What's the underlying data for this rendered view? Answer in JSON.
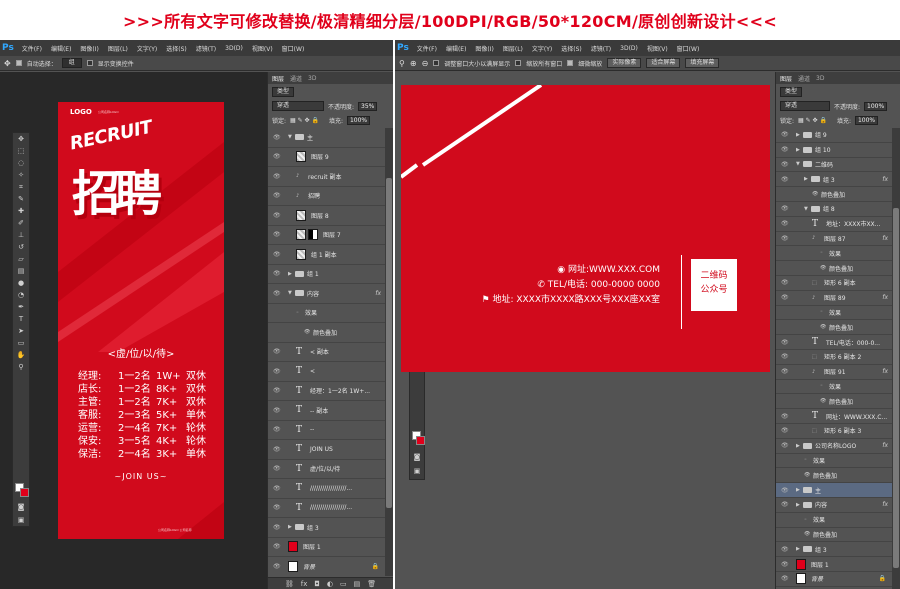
{
  "banner": ">>>所有文字可修改替换/极清精细分层/100DPI/RGB/50*120CM/原创创新设计<<<",
  "colors": {
    "accent": "#e0001b",
    "ps_bg": "#535353",
    "menubar": "#3a3a3a",
    "canvas_bg": "#282828",
    "poster_red": "#d10a1c",
    "selection": "#5b6a82"
  },
  "ps_logo": "Ps",
  "menu": [
    "文件(F)",
    "编辑(E)",
    "图像(I)",
    "图层(L)",
    "文字(Y)",
    "选择(S)",
    "滤镜(T)",
    "3D(D)",
    "视图(V)",
    "窗口(W)"
  ],
  "left_window": {
    "options": {
      "auto_select": "自动选择：",
      "target": "组",
      "show_transform": "显示变换控件"
    },
    "layers_panel": {
      "tabs": [
        "图层",
        "通道",
        "3D"
      ],
      "kind": "类型",
      "blend": "穿透",
      "opacity_label": "不透明度:",
      "opacity": "35%",
      "lock_label": "锁定:",
      "fill_label": "填充:",
      "fill": "100%",
      "layers": [
        {
          "name": "主",
          "type": "folder",
          "indent": 0,
          "open": true
        },
        {
          "name": "图层 9",
          "type": "checker",
          "indent": 1
        },
        {
          "name": "recruit 副本",
          "type": "smart",
          "indent": 1
        },
        {
          "name": "招聘",
          "type": "smart",
          "indent": 1
        },
        {
          "name": "图层 8",
          "type": "checker",
          "indent": 1
        },
        {
          "name": "图层 7",
          "type": "mask",
          "indent": 1
        },
        {
          "name": "组 1 副本",
          "type": "checker",
          "indent": 1
        },
        {
          "name": "组 1",
          "type": "folder",
          "indent": 0,
          "open": false
        },
        {
          "name": "内容",
          "type": "folder",
          "indent": 0,
          "open": true,
          "fx": "fx"
        },
        {
          "name": "效果",
          "type": "effect",
          "indent": 1
        },
        {
          "name": "颜色叠加",
          "type": "effect-item",
          "indent": 2
        },
        {
          "name": "< 副本",
          "type": "text",
          "indent": 1
        },
        {
          "name": "<",
          "type": "text",
          "indent": 1
        },
        {
          "name": "经理：1一2名 1W+...",
          "type": "text",
          "indent": 1
        },
        {
          "name": "-- 副本",
          "type": "text",
          "indent": 1
        },
        {
          "name": "--",
          "type": "text",
          "indent": 1
        },
        {
          "name": "JOIN US",
          "type": "text",
          "indent": 1
        },
        {
          "name": "虚/位/以/待",
          "type": "text",
          "indent": 1
        },
        {
          "name": "//////////////////...",
          "type": "text",
          "indent": 1
        },
        {
          "name": "//////////////////...",
          "type": "text",
          "indent": 1
        },
        {
          "name": "组 3",
          "type": "folder",
          "indent": 0,
          "open": false
        },
        {
          "name": "图层 1",
          "type": "red",
          "indent": 0
        },
        {
          "name": "背景",
          "type": "white",
          "indent": 0,
          "locked": true
        }
      ]
    },
    "bottom_icons": [
      "⛓",
      "fx",
      "◘",
      "◐",
      "▭",
      "▤",
      "🗑"
    ]
  },
  "poster": {
    "logo": "LOGO",
    "logo_sub": "公司名称LOGO",
    "recruit": "RECRUIT",
    "title": "招聘",
    "subtitle": "<虚/位/以/待>",
    "jobs": [
      {
        "role": "经理:",
        "count": "1一2名",
        "pay": "1W+",
        "rest": "双休"
      },
      {
        "role": "店长:",
        "count": "1一2名",
        "pay": "8K+",
        "rest": "双休"
      },
      {
        "role": "主管:",
        "count": "1一2名",
        "pay": "7K+",
        "rest": "双休"
      },
      {
        "role": "客服:",
        "count": "2一3名",
        "pay": "5K+",
        "rest": "单休"
      },
      {
        "role": "运营:",
        "count": "2一4名",
        "pay": "7K+",
        "rest": "轮休"
      },
      {
        "role": "保安:",
        "count": "3一5名",
        "pay": "4K+",
        "rest": "轮休"
      },
      {
        "role": "保洁:",
        "count": "2一4名",
        "pay": "3K+",
        "rest": "单休"
      }
    ],
    "join": "~JOIN US~",
    "footer": "公司名称LOGO 公司名称"
  },
  "right_window": {
    "options": [
      "调整窗口大小以满屏显示",
      "缩放所有窗口",
      "细微缩放",
      "实际像素",
      "适合屏幕",
      "填充屏幕"
    ],
    "layers_panel": {
      "tabs": [
        "图层",
        "通道",
        "3D"
      ],
      "kind": "类型",
      "blend": "穿透",
      "opacity_label": "不透明度:",
      "opacity": "100%",
      "lock_label": "锁定:",
      "fill_label": "填充:",
      "fill": "100%",
      "layers": [
        {
          "name": "组 9",
          "type": "folder",
          "indent": 0,
          "open": false
        },
        {
          "name": "组 10",
          "type": "folder",
          "indent": 0,
          "open": false
        },
        {
          "name": "二维码",
          "type": "folder",
          "indent": 0,
          "open": true
        },
        {
          "name": "组 3",
          "type": "folder",
          "indent": 1,
          "open": false,
          "fx": "fx"
        },
        {
          "name": "颜色叠加",
          "type": "effect-item",
          "indent": 2
        },
        {
          "name": "组 8",
          "type": "folder",
          "indent": 1,
          "open": true
        },
        {
          "name": "地址：XXXX市XX...",
          "type": "text",
          "indent": 2
        },
        {
          "name": "图层 87",
          "type": "smart",
          "indent": 2,
          "fx": "fx"
        },
        {
          "name": "效果",
          "type": "effect",
          "indent": 3
        },
        {
          "name": "颜色叠加",
          "type": "effect-item",
          "indent": 3
        },
        {
          "name": "矩形 6 副本",
          "type": "shape",
          "indent": 2
        },
        {
          "name": "图层 89",
          "type": "smart",
          "indent": 2,
          "fx": "fx"
        },
        {
          "name": "效果",
          "type": "effect",
          "indent": 3
        },
        {
          "name": "颜色叠加",
          "type": "effect-item",
          "indent": 3
        },
        {
          "name": "TEL/电话：000-0...",
          "type": "text",
          "indent": 2
        },
        {
          "name": "矩形 6 副本 2",
          "type": "shape",
          "indent": 2
        },
        {
          "name": "图层 91",
          "type": "smart",
          "indent": 2,
          "fx": "fx"
        },
        {
          "name": "效果",
          "type": "effect",
          "indent": 3
        },
        {
          "name": "颜色叠加",
          "type": "effect-item",
          "indent": 3
        },
        {
          "name": "网址：WWW.XXX.C...",
          "type": "text",
          "indent": 2
        },
        {
          "name": "矩形 6 副本 3",
          "type": "shape",
          "indent": 2
        },
        {
          "name": "公司名称LOGO",
          "type": "folder",
          "indent": 0,
          "open": false,
          "fx": "fx"
        },
        {
          "name": "效果",
          "type": "effect",
          "indent": 1
        },
        {
          "name": "颜色叠加",
          "type": "effect-item",
          "indent": 1
        },
        {
          "name": "主",
          "type": "folder",
          "indent": 0,
          "open": false,
          "selected": true
        },
        {
          "name": "内容",
          "type": "folder",
          "indent": 0,
          "open": false,
          "fx": "fx"
        },
        {
          "name": "效果",
          "type": "effect",
          "indent": 1
        },
        {
          "name": "颜色叠加",
          "type": "effect-item",
          "indent": 1
        },
        {
          "name": "组 3",
          "type": "folder",
          "indent": 0,
          "open": false
        },
        {
          "name": "图层 1",
          "type": "red",
          "indent": 0
        },
        {
          "name": "背景",
          "type": "white",
          "indent": 0,
          "locked": true
        }
      ]
    }
  },
  "card": {
    "website": "网址:WWW.XXX.COM",
    "tel": "TEL/电话: 000-0000 0000",
    "address": "地址: XXXX市XXXX路XXX号XXX座XX室",
    "qr": "二维码\n公众号",
    "qr_line1": "二维码",
    "qr_line2": "公众号"
  }
}
